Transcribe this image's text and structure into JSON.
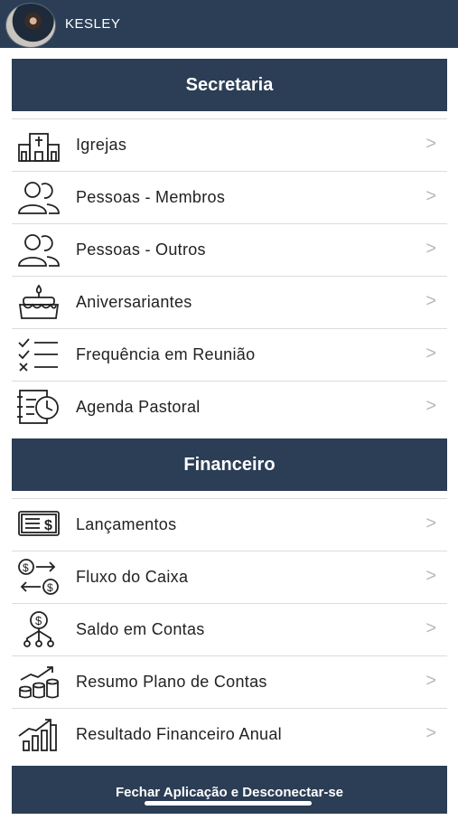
{
  "header": {
    "user_name": "KESLEY"
  },
  "sections": [
    {
      "title": "Secretaria",
      "items": [
        {
          "label": "Igrejas",
          "icon": "church-icon"
        },
        {
          "label": "Pessoas - Membros",
          "icon": "people-icon"
        },
        {
          "label": "Pessoas - Outros",
          "icon": "people-icon"
        },
        {
          "label": "Aniversariantes",
          "icon": "cake-icon"
        },
        {
          "label": "Frequência em Reunião",
          "icon": "checklist-icon"
        },
        {
          "label": "Agenda Pastoral",
          "icon": "agenda-clock-icon"
        }
      ]
    },
    {
      "title": "Financeiro",
      "items": [
        {
          "label": "Lançamentos",
          "icon": "bill-icon"
        },
        {
          "label": "Fluxo do Caixa",
          "icon": "cash-flow-icon"
        },
        {
          "label": "Saldo em Contas",
          "icon": "money-network-icon"
        },
        {
          "label": "Resumo Plano de Contas",
          "icon": "coins-growth-icon"
        },
        {
          "label": "Resultado Financeiro Anual",
          "icon": "bar-chart-icon"
        }
      ]
    }
  ],
  "chevron": ">",
  "logout_label": "Fechar Aplicação e Desconectar-se",
  "colors": {
    "header_bg": "#2b3e55",
    "text": "#222222",
    "chevron": "#b8b8b8"
  }
}
